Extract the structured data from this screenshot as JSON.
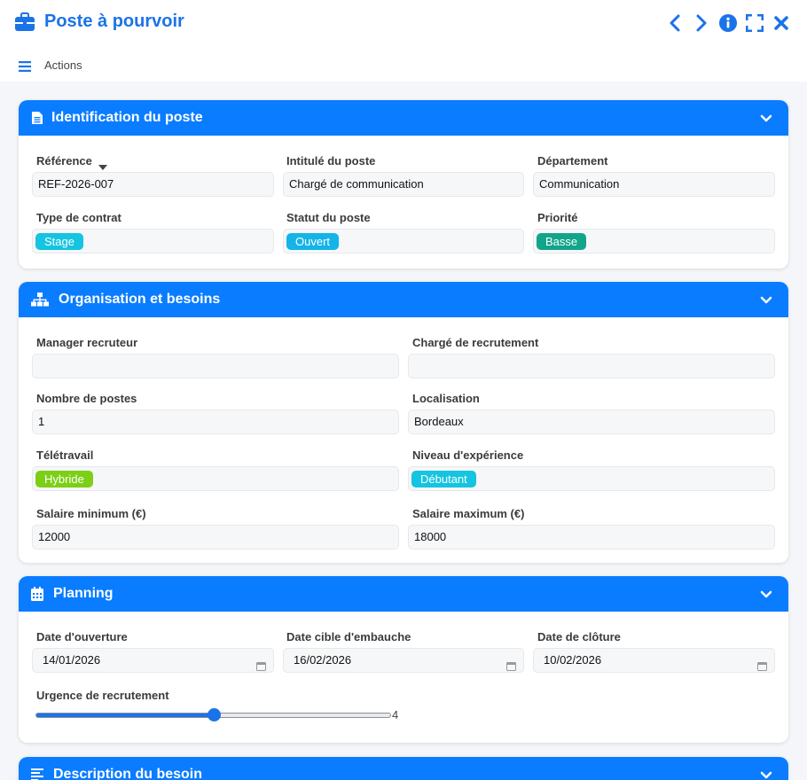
{
  "window": {
    "title": "Poste à pourvoir",
    "actions_label": "Actions"
  },
  "sections": {
    "identification": {
      "title": "Identification du poste",
      "reference_label": "Référence",
      "reference_value": "REF-2026-007",
      "intitule_label": "Intitulé du poste",
      "intitule_value": "Chargé de communication",
      "departement_label": "Département",
      "departement_value": "Communication",
      "contrat_label": "Type de contrat",
      "contrat_value": "Stage",
      "statut_label": "Statut du poste",
      "statut_value": "Ouvert",
      "priorite_label": "Priorité",
      "priorite_value": "Basse"
    },
    "organisation": {
      "title": "Organisation et besoins",
      "manager_label": "Manager recruteur",
      "manager_value": "",
      "charge_label": "Chargé de recrutement",
      "charge_value": "",
      "nombre_label": "Nombre de postes",
      "nombre_value": "1",
      "localisation_label": "Localisation",
      "localisation_value": "Bordeaux",
      "teletravail_label": "Télétravail",
      "teletravail_value": "Hybride",
      "niveau_label": "Niveau d'expérience",
      "niveau_value": "Débutant",
      "salaire_min_label": "Salaire minimum (€)",
      "salaire_min_value": "12000",
      "salaire_max_label": "Salaire maximum (€)",
      "salaire_max_value": "18000"
    },
    "planning": {
      "title": "Planning",
      "ouverture_label": "Date d'ouverture",
      "ouverture_value": "14/01/2026",
      "embauche_label": "Date cible d'embauche",
      "embauche_value": "16/02/2026",
      "cloture_label": "Date de clôture",
      "cloture_value": "10/02/2026",
      "urgence_label": "Urgence de recrutement",
      "urgence_value": "4",
      "urgence_fraction": 0.5
    },
    "description": {
      "title": "Description du besoin"
    }
  },
  "colors": {
    "accent": "#0a7cff",
    "badge_cyan": "#14c4e0",
    "badge_teal": "#12a58a",
    "badge_green": "#7ccf16"
  }
}
